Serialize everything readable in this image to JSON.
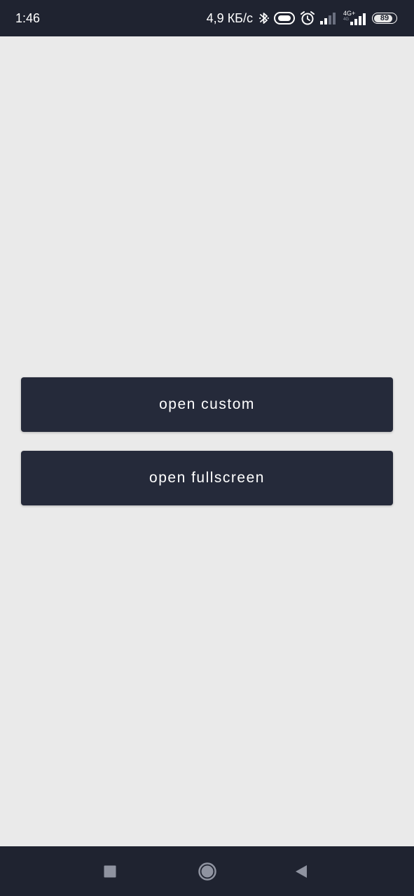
{
  "status_bar": {
    "time": "1:46",
    "net_speed": "4,9 КБ/с",
    "network_type": "4G+",
    "network_sub": "4G",
    "battery_level": "89",
    "battery_fraction": 0.89,
    "icons": [
      "bluetooth-icon",
      "vowifi-icon",
      "alarm-icon",
      "signal-weak-icon",
      "signal-strong-icon",
      "battery-icon"
    ]
  },
  "main": {
    "buttons": [
      {
        "label": "open custom"
      },
      {
        "label": "open fullscreen"
      }
    ]
  },
  "nav_bar": {
    "icons": [
      "recents-icon",
      "home-icon",
      "back-icon"
    ]
  },
  "colors": {
    "background": "#eaeaea",
    "bar": "#1f2330",
    "button": "#252a3a",
    "button_text": "#ffffff"
  }
}
